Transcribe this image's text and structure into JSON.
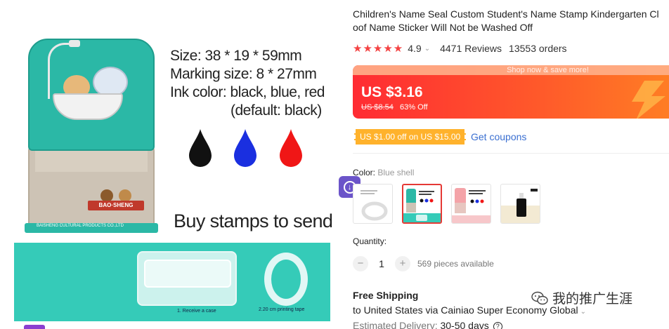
{
  "product": {
    "title": "Children's Name Seal Custom Student's Name Stamp Kindergarten Cl oof Name Sticker Will Not be Washed Off",
    "title_line1": "Children's Name Seal Custom Student's Name Stamp Kindergarten Cl",
    "title_line2": "oof Name Sticker Will Not be Washed Off",
    "rating_stars": "★★★★★",
    "rating": "4.9",
    "reviews": "4471 Reviews",
    "orders": "13553 orders"
  },
  "image": {
    "spec_size": "Size:  38 * 19 * 59mm",
    "spec_marking": "Marking size:  8 * 27mm",
    "spec_ink": "Ink color:  black, blue, red",
    "spec_default": "(default: black)",
    "buy_text": "Buy stamps to send",
    "stamp_plate_text": "BAISHENG CULTURAL PRODUCTS CO.,LTD",
    "logo_text": "BAO·SHENG",
    "caption_case": "1. Receive a case",
    "caption_tape": "2.20 cm printing tape",
    "ink_colors": [
      "#111111",
      "#1a2fe0",
      "#f01616"
    ]
  },
  "price": {
    "banner": "Shop now & save more!",
    "current": "US $3.16",
    "original": "US $8.54",
    "discount": "63% Off",
    "gradient_start": "#ff2b33",
    "gradient_end": "#ff7d24"
  },
  "coupon": {
    "tag": "US $1.00 off on US $15.00",
    "link": "Get coupons"
  },
  "color": {
    "label": "Color:",
    "value": "Blue shell",
    "options": [
      "Blue shell (selected)",
      "Pink shell",
      "Ink"
    ]
  },
  "quantity": {
    "label": "Quantity:",
    "minus": "−",
    "value": "1",
    "plus": "+",
    "available": "569 pieces available"
  },
  "shipping": {
    "title": "Free Shipping",
    "to": "to United States via Cainiao Super Economy Global",
    "delivery_label": "Estimated Delivery:",
    "delivery_value": "30-50 days",
    "help": "?"
  },
  "watermark": {
    "text": "我的推广生涯"
  },
  "icons": {
    "download": "download-circle-icon",
    "chevron": "chevron-down-icon",
    "help": "question-circle-icon",
    "wechat": "wechat-icon"
  }
}
